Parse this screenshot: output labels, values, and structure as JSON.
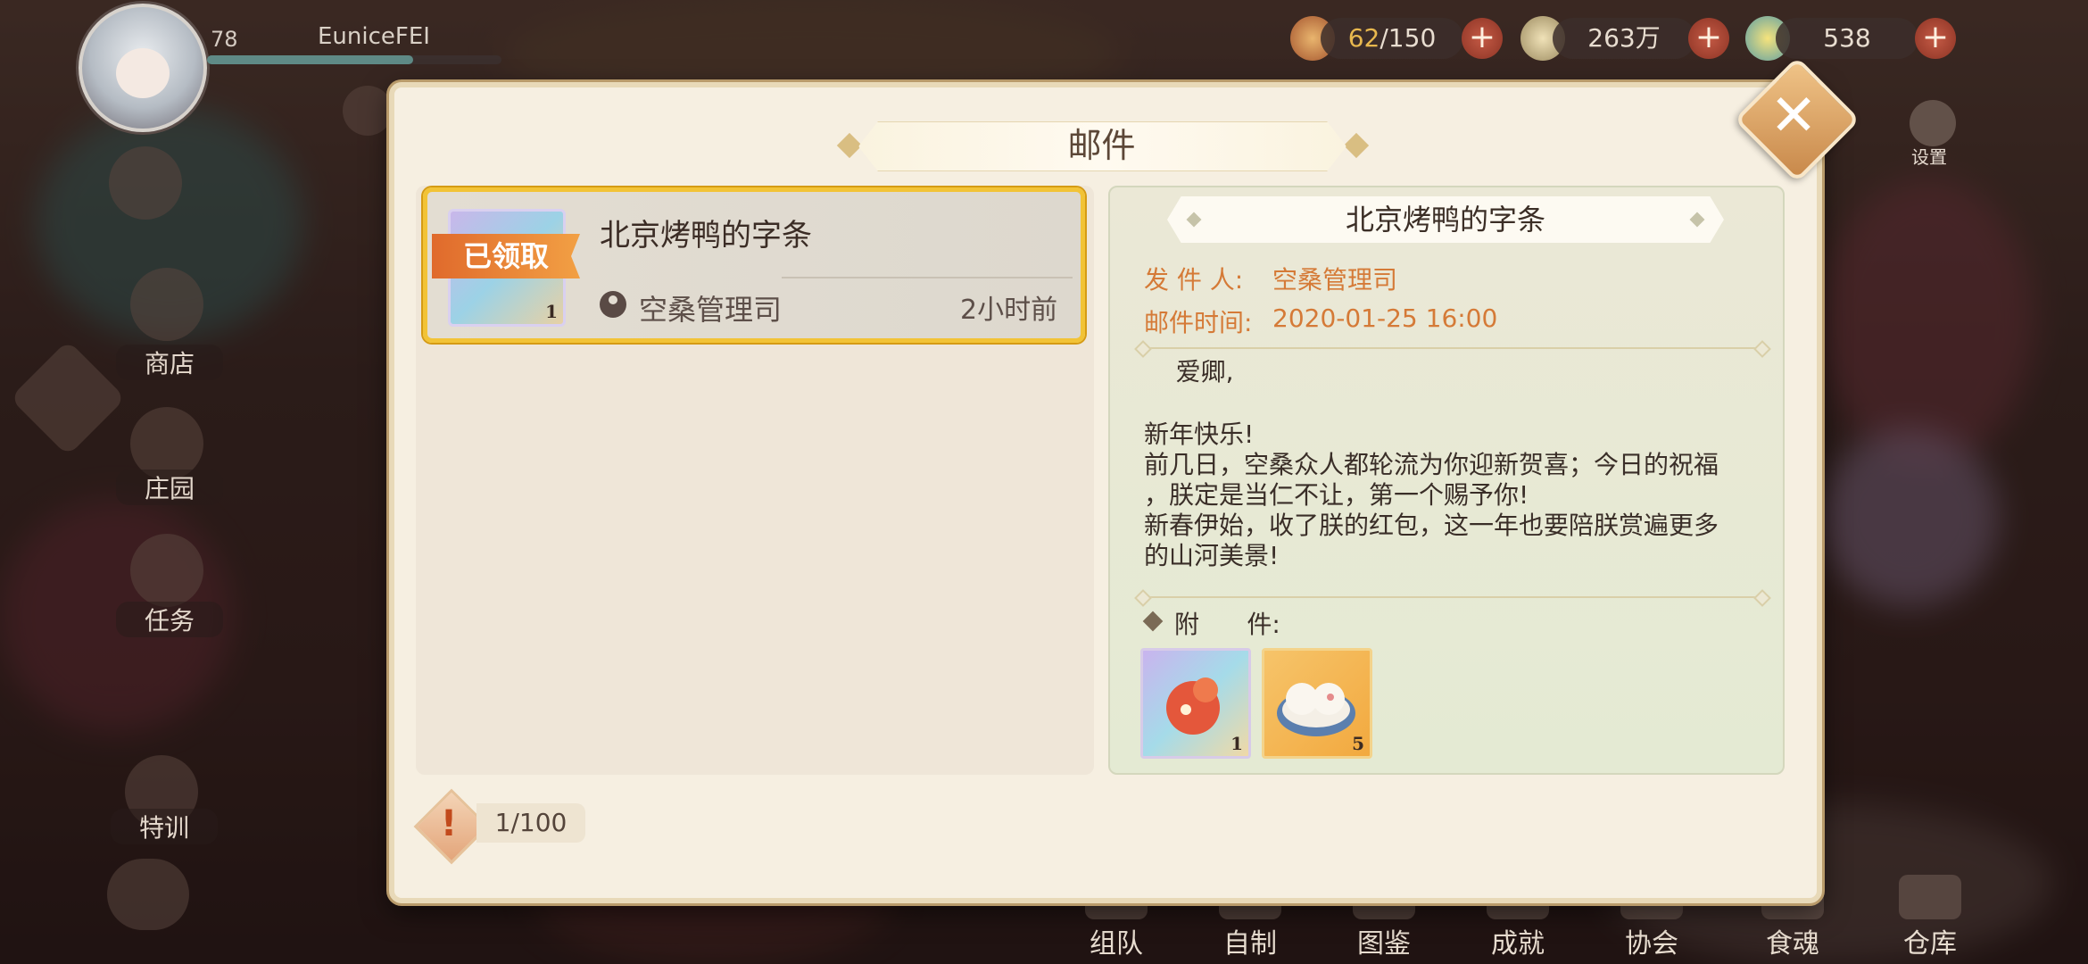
{
  "player": {
    "level": "78",
    "name": "EuniceFEI",
    "exp_progress": 0.7
  },
  "resources": [
    {
      "icon": "rice-bowl-icon",
      "current": "62",
      "max": "/150"
    },
    {
      "icon": "leaf-coin-icon",
      "value": "263万"
    },
    {
      "icon": "gem-icon",
      "value": "538"
    }
  ],
  "side_menu": {
    "shop": "商店",
    "manor": "庄园",
    "tasks": "任务",
    "training": "特训"
  },
  "top_right": {
    "settings": "设置"
  },
  "bottom_nav": [
    "组队",
    "自制",
    "图鉴",
    "成就",
    "协会",
    "食魂",
    "仓库"
  ],
  "dialog": {
    "title": "邮件",
    "mail_list": [
      {
        "subject": "北京烤鸭的字条",
        "status_tag": "已领取",
        "sender": "空桑管理司",
        "time": "2小时前",
        "thumb_count": "1"
      }
    ],
    "mail_count": "1/100",
    "detail": {
      "title": "北京烤鸭的字条",
      "sender_label": "发 件 人:",
      "sender": "空桑管理司",
      "time_label": "邮件时间:",
      "time": "2020-01-25 16:00",
      "body_lines": [
        "    爱卿,",
        "",
        "新年快乐!",
        "前几日，空桑众人都轮流为你迎新贺喜；今日的祝福",
        "，朕定是当仁不让，第一个赐予你!",
        "新春伊始，收了朕的红包，这一年也要陪朕赏遍更多",
        "的山河美景!"
      ],
      "attachments_label": "附      件:",
      "attachments": [
        {
          "icon": "fire-spirit-icon",
          "count": "1"
        },
        {
          "icon": "rice-dumpling-icon",
          "count": "5"
        }
      ]
    }
  }
}
